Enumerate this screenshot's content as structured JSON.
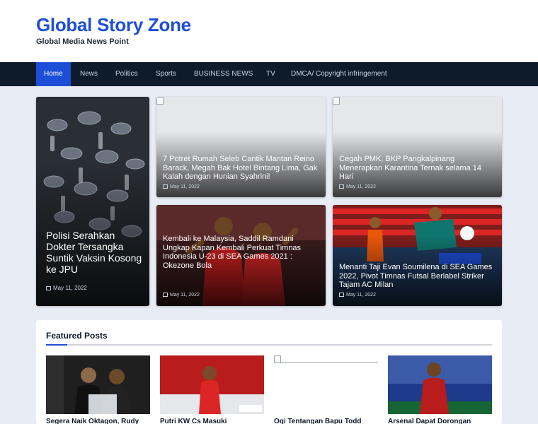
{
  "header": {
    "site_title": "Global Story Zone",
    "tagline": "Global Media News Point"
  },
  "nav": {
    "items": [
      {
        "label": "Home",
        "active": true
      },
      {
        "label": "News"
      },
      {
        "label": "Politics"
      },
      {
        "label": "Sports"
      },
      {
        "label": "BUSINESS NEWS"
      },
      {
        "label": "TV"
      },
      {
        "label": "DMCA/ Copyright infringement"
      }
    ]
  },
  "cards": [
    {
      "title": "Polisi Serahkan Dokter Tersangka Suntik Vaksin Kosong ke JPU",
      "date": "May 11, 2022"
    },
    {
      "title": "7 Potret Rumah Seleb Cantik Mantan Reino Barack, Megah Bak Hotel Bintang Lima, Gak Kalah dengan Hunian Syahrini!",
      "date": "May 11, 2022"
    },
    {
      "title": "Cegah PMK, BKP Pangkalpinang Menerapkan Karantina Ternak selama 14 Hari",
      "date": "May 11, 2022"
    },
    {
      "title": "Kembali ke Malaysia, Saddil Ramdani Ungkap Kapan Kembali Perkuat Timnas Indonesia U-23 di SEA Games 2021 : Okezone Bola",
      "date": "May 11, 2022"
    },
    {
      "title": "Menanti Taji Evan Soumilena di SEA Games 2022, Pivot Timnas Futsal Berlabel Striker Tajam AC Milan",
      "date": "May 11, 2022"
    }
  ],
  "featured": {
    "heading": "Featured Posts",
    "posts": [
      {
        "title": "Segera Naik Oktagon, Rudy"
      },
      {
        "title": "Putri KW Cs Masuki"
      },
      {
        "title": "Oqi Tentangan Bapu Todd"
      },
      {
        "title": "Arsenal Dapat Dorongan"
      }
    ]
  },
  "colors": {
    "brand": "#1d4ed8",
    "nav_bg": "#0d1b2a",
    "page_bg": "#e8edf5"
  }
}
